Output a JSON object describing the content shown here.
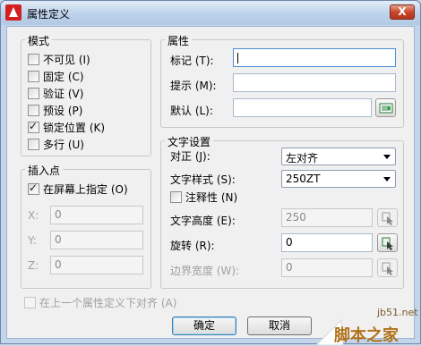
{
  "window": {
    "title": "属性定义",
    "close_symbol": "X"
  },
  "mode": {
    "title": "模式",
    "options": [
      {
        "label": "不可见 (I)",
        "checked": false
      },
      {
        "label": "固定 (C)",
        "checked": false
      },
      {
        "label": "验证 (V)",
        "checked": false
      },
      {
        "label": "预设 (P)",
        "checked": false
      },
      {
        "label": "锁定位置 (K)",
        "checked": true
      },
      {
        "label": "多行 (U)",
        "checked": false
      }
    ]
  },
  "insertion": {
    "title": "插入点",
    "specify_on_screen": {
      "label": "在屏幕上指定 (O)",
      "checked": true
    },
    "x": {
      "label": "X:",
      "value": "0"
    },
    "y": {
      "label": "Y:",
      "value": "0"
    },
    "z": {
      "label": "Z:",
      "value": "0"
    }
  },
  "attribute": {
    "title": "属性",
    "tag": {
      "label": "标记 (T):",
      "value": ""
    },
    "prompt": {
      "label": "提示 (M):",
      "value": ""
    },
    "default": {
      "label": "默认 (L):",
      "value": ""
    }
  },
  "text": {
    "title": "文字设置",
    "justification": {
      "label": "对正 (J):",
      "value": "左对齐"
    },
    "style": {
      "label": "文字样式 (S):",
      "value": "250ZT"
    },
    "annotative": {
      "label": "注释性 (N)",
      "checked": false
    },
    "height": {
      "label": "文字高度 (E):",
      "value": "250"
    },
    "rotation": {
      "label": "旋转 (R):",
      "value": "0"
    },
    "boundary_width": {
      "label": "边界宽度 (W):",
      "value": "0"
    }
  },
  "align_below": {
    "label": "在上一个属性定义下对齐 (A)",
    "checked": false
  },
  "buttons": {
    "ok": "确定",
    "cancel": "取消"
  },
  "watermark": {
    "site": "jb51.net",
    "text": "脚本之家"
  },
  "colors": {
    "title_bar": "#bcd1ea",
    "close_button": "#c8472c",
    "dialog_bg": "#f0f0f0"
  }
}
